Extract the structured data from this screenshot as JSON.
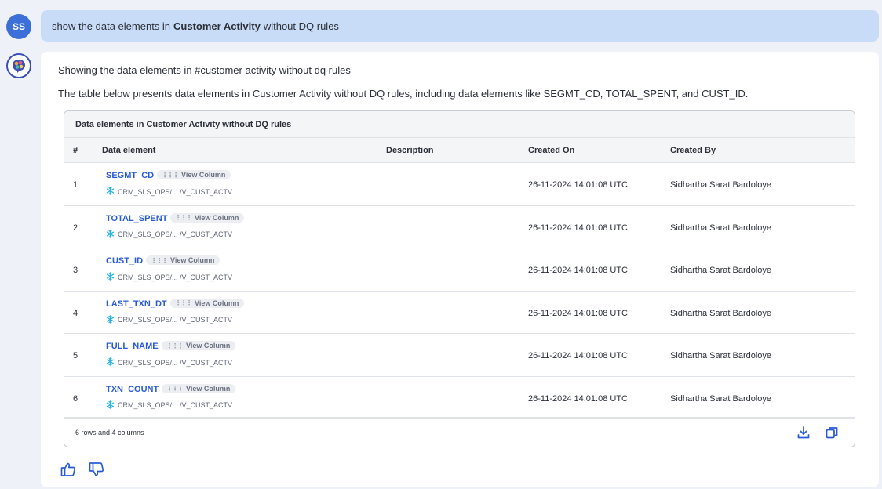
{
  "user": {
    "avatar_initials": "SS",
    "message_prefix": "show the data elements in",
    "message_bold": "Customer Activity",
    "message_suffix": "without DQ rules"
  },
  "response": {
    "line1": "Showing the data elements in #customer activity without dq rules",
    "line2": "The table below presents data elements in Customer Activity without DQ rules, including data elements like SEGMT_CD, TOTAL_SPENT, and CUST_ID."
  },
  "table": {
    "title": "Data elements in Customer Activity without DQ rules",
    "columns": {
      "num": "#",
      "element": "Data element",
      "description": "Description",
      "created_on": "Created On",
      "created_by": "Created By"
    },
    "view_column_label": "View Column",
    "rows": [
      {
        "num": "1",
        "name": "SEGMT_CD",
        "path": "CRM_SLS_OPS/... /V_CUST_ACTV",
        "created_on": "26-11-2024 14:01:08 UTC",
        "created_by": "Sidhartha Sarat Bardoloye"
      },
      {
        "num": "2",
        "name": "TOTAL_SPENT",
        "path": "CRM_SLS_OPS/... /V_CUST_ACTV",
        "created_on": "26-11-2024 14:01:08 UTC",
        "created_by": "Sidhartha Sarat Bardoloye"
      },
      {
        "num": "3",
        "name": "CUST_ID",
        "path": "CRM_SLS_OPS/... /V_CUST_ACTV",
        "created_on": "26-11-2024 14:01:08 UTC",
        "created_by": "Sidhartha Sarat Bardoloye"
      },
      {
        "num": "4",
        "name": "LAST_TXN_DT",
        "path": "CRM_SLS_OPS/... /V_CUST_ACTV",
        "created_on": "26-11-2024 14:01:08 UTC",
        "created_by": "Sidhartha Sarat Bardoloye"
      },
      {
        "num": "5",
        "name": "FULL_NAME",
        "path": "CRM_SLS_OPS/... /V_CUST_ACTV",
        "created_on": "26-11-2024 14:01:08 UTC",
        "created_by": "Sidhartha Sarat Bardoloye"
      },
      {
        "num": "6",
        "name": "TXN_COUNT",
        "path": "CRM_SLS_OPS/... /V_CUST_ACTV",
        "created_on": "26-11-2024 14:01:08 UTC",
        "created_by": "Sidhartha Sarat Bardoloye"
      }
    ],
    "footer": "6 rows and 4 columns"
  },
  "icons": {
    "snowflake": "snowflake-icon",
    "download": "download-icon",
    "copy": "copy-icon",
    "thumbs_up": "thumbs-up-icon",
    "thumbs_down": "thumbs-down-icon",
    "assistant": "assistant-logo-icon"
  },
  "colors": {
    "accent": "#2a5bd7",
    "user_bubble": "#c9dcf7",
    "avatar": "#3d6fd8",
    "snowflake": "#29b5e8"
  }
}
